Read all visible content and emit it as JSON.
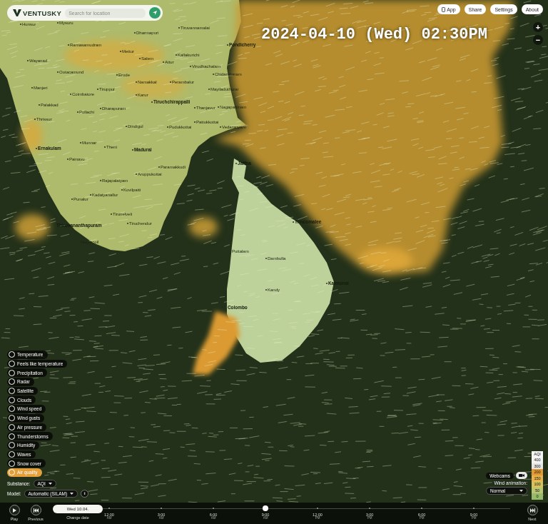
{
  "logo": "VENTUSKY",
  "search": {
    "placeholder": "Search for location"
  },
  "datetime": "2024-04-10 (Wed) 02:30PM",
  "top_buttons": [
    "App",
    "Share",
    "Settings",
    "About"
  ],
  "zoom": [
    "+",
    "−"
  ],
  "places": [
    {
      "name": "Hunsur",
      "major": false
    },
    {
      "name": "Mysuru",
      "major": false
    },
    {
      "name": "Dharmapuri",
      "major": false
    },
    {
      "name": "Tiruvannamalai",
      "major": false
    },
    {
      "name": "Ramasamudram",
      "major": false
    },
    {
      "name": "Mettur",
      "major": false
    },
    {
      "name": "Salem",
      "major": false
    },
    {
      "name": "Attur",
      "major": false
    },
    {
      "name": "Kallakurichi",
      "major": false
    },
    {
      "name": "Pondicherry",
      "major": true
    },
    {
      "name": "Wayanad",
      "major": false
    },
    {
      "name": "Virudhachalam",
      "major": false
    },
    {
      "name": "Ootacamund",
      "major": false
    },
    {
      "name": "Erode",
      "major": false
    },
    {
      "name": "Chidambaram",
      "major": false
    },
    {
      "name": "Namakkal",
      "major": false
    },
    {
      "name": "Perambalur",
      "major": false
    },
    {
      "name": "Manjeri",
      "major": false
    },
    {
      "name": "Tiruppur",
      "major": false
    },
    {
      "name": "Mayiladuthurai",
      "major": false
    },
    {
      "name": "Coimbatore",
      "major": false
    },
    {
      "name": "Karur",
      "major": false
    },
    {
      "name": "Palakkad",
      "major": false
    },
    {
      "name": "Dharapuram",
      "major": false
    },
    {
      "name": "Tiruchchirappalli",
      "major": true
    },
    {
      "name": "Thanjavur",
      "major": false
    },
    {
      "name": "Nagapattinam",
      "major": false
    },
    {
      "name": "Pollachi",
      "major": false
    },
    {
      "name": "Thrissur",
      "major": false
    },
    {
      "name": "Dindigul",
      "major": false
    },
    {
      "name": "Pudukkottai",
      "major": false
    },
    {
      "name": "Pattukkottai",
      "major": false
    },
    {
      "name": "Vedaranyam",
      "major": false
    },
    {
      "name": "Munnar",
      "major": false
    },
    {
      "name": "Theni",
      "major": false
    },
    {
      "name": "Madurai",
      "major": true
    },
    {
      "name": "Ernakulam",
      "major": true
    },
    {
      "name": "Painavu",
      "major": false
    },
    {
      "name": "Paramakkudi",
      "major": false
    },
    {
      "name": "Aruppukottai",
      "major": false
    },
    {
      "name": "Rajapalaiyam",
      "major": false
    },
    {
      "name": "Jaffna",
      "major": true
    },
    {
      "name": "Kovilpatti",
      "major": false
    },
    {
      "name": "Kadaiyanallur",
      "major": false
    },
    {
      "name": "Punalur",
      "major": false
    },
    {
      "name": "Tirunelveli",
      "major": false
    },
    {
      "name": "Trincomalee",
      "major": true
    },
    {
      "name": "Thiruvananthapuram",
      "major": true
    },
    {
      "name": "Tiruchendur",
      "major": false
    },
    {
      "name": "Nagercoil",
      "major": false
    },
    {
      "name": "Puttalam",
      "major": false
    },
    {
      "name": "Dambulla",
      "major": false
    },
    {
      "name": "Kandy",
      "major": false
    },
    {
      "name": "Kalmunai",
      "major": true
    },
    {
      "name": "Colombo",
      "major": true
    }
  ],
  "layers": [
    {
      "label": "Temperature",
      "selected": false
    },
    {
      "label": "Feels like temperature",
      "selected": false
    },
    {
      "label": "Precipitation",
      "selected": false
    },
    {
      "label": "Radar",
      "selected": false
    },
    {
      "label": "Satellite",
      "selected": false
    },
    {
      "label": "Clouds",
      "selected": false
    },
    {
      "label": "Wind speed",
      "selected": false
    },
    {
      "label": "Wind gusts",
      "selected": false
    },
    {
      "label": "Air pressure",
      "selected": false
    },
    {
      "label": "Thunderstorms",
      "selected": false
    },
    {
      "label": "Humidity",
      "selected": false
    },
    {
      "label": "Waves",
      "selected": false
    },
    {
      "label": "Snow cover",
      "selected": false
    },
    {
      "label": "Air quality",
      "selected": true
    }
  ],
  "substance": {
    "label": "Substance:",
    "value": "AQI"
  },
  "model": {
    "label": "Model:",
    "value": "Automatic (SILAM)",
    "info": "i"
  },
  "legend": {
    "title": "AQI",
    "steps": [
      {
        "label": "400",
        "color": "#f2f2f2"
      },
      {
        "label": "300",
        "color": "#e6e6e6"
      },
      {
        "label": "200",
        "color": "#e39a35"
      },
      {
        "label": "150",
        "color": "#e9b24a"
      },
      {
        "label": "100",
        "color": "#d8c25c"
      },
      {
        "label": "50",
        "color": "#b9c674"
      },
      {
        "label": "0",
        "color": "#97bb6a"
      }
    ]
  },
  "webcams": {
    "label": "Webcams",
    "on": false
  },
  "wind_animation": {
    "label": "Wind animation:",
    "value": "Normal"
  },
  "timeline": {
    "play": "Play",
    "previous": "Previous",
    "next": "Next",
    "date": "Wed 10.04.",
    "change_date": "Change date",
    "ticks": [
      {
        "time": "12:00",
        "period": "AM",
        "selected": false
      },
      {
        "time": "3:00",
        "period": "AM",
        "selected": false
      },
      {
        "time": "6:00",
        "period": "AM",
        "selected": false
      },
      {
        "time": "9:00",
        "period": "AM",
        "selected": true
      },
      {
        "time": "12:00",
        "period": "PM",
        "selected": false
      },
      {
        "time": "3:00",
        "period": "PM",
        "selected": false
      },
      {
        "time": "6:00",
        "period": "PM",
        "selected": false
      },
      {
        "time": "9:00",
        "period": "PM",
        "selected": false
      }
    ]
  }
}
